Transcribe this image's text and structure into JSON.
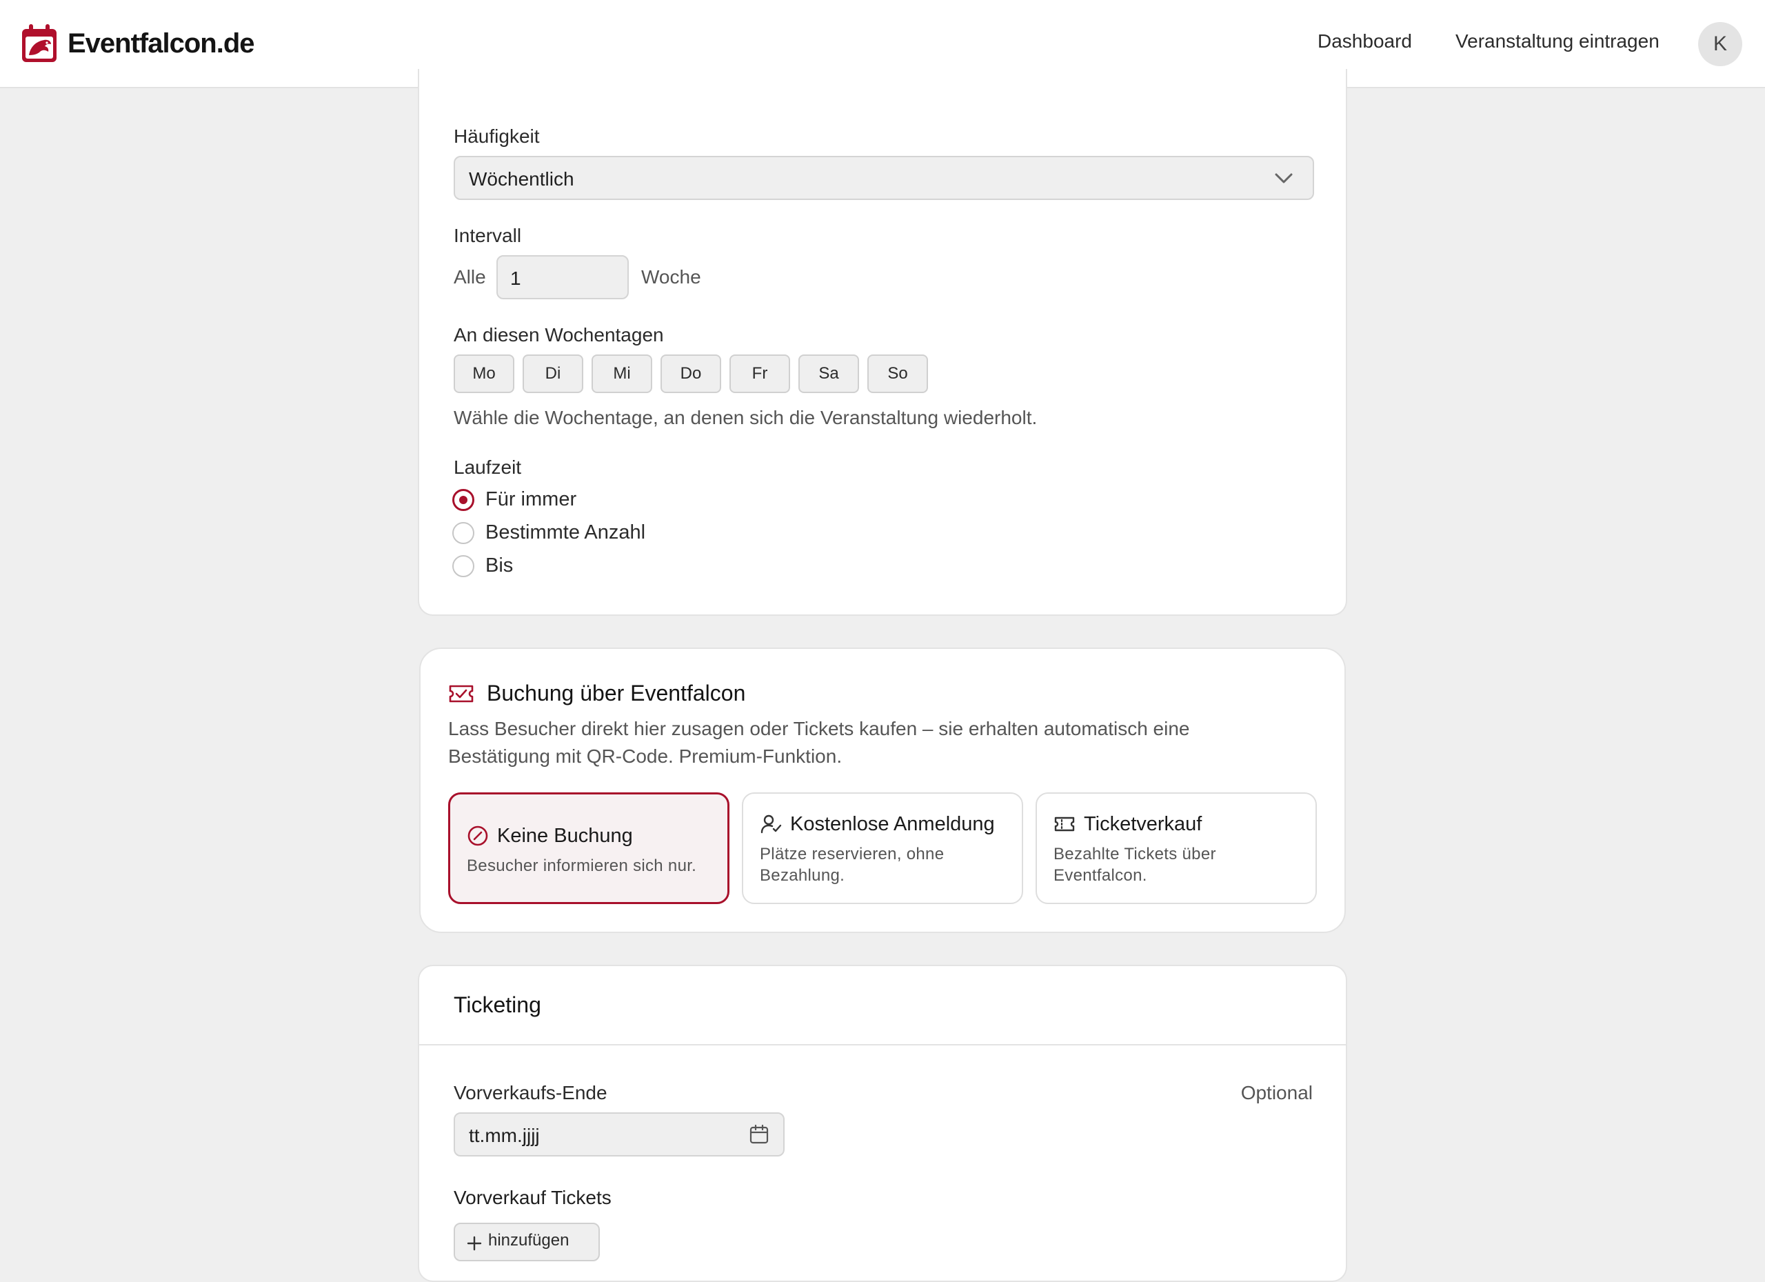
{
  "colors": {
    "accent": "#a8102b",
    "page_bg": "#efefef",
    "card_bg": "#ffffff"
  },
  "header": {
    "brand": "Eventfalcon.de",
    "nav": [
      "Dashboard",
      "Veranstaltung eintragen"
    ],
    "avatar_initial": "K"
  },
  "recurrence": {
    "frequency_label": "Häufigkeit",
    "frequency_value": "Wöchentlich",
    "interval_label": "Intervall",
    "interval_prefix": "Alle",
    "interval_value": "1",
    "interval_unit": "Woche",
    "weekdays_label": "An diesen Wochentagen",
    "weekdays": [
      "Mo",
      "Di",
      "Mi",
      "Do",
      "Fr",
      "Sa",
      "So"
    ],
    "weekdays_help": "Wähle die Wochentage, an denen sich die Veranstaltung wiederholt.",
    "duration_label": "Laufzeit",
    "duration_options": [
      "Für immer",
      "Bestimmte Anzahl",
      "Bis"
    ],
    "duration_selected": "Für immer"
  },
  "booking": {
    "title": "Buchung über Eventfalcon",
    "description_line1": "Lass Besucher direkt hier zusagen oder Tickets kaufen – sie erhalten automatisch eine",
    "description_line2": "Bestätigung mit QR-Code. Premium-Funktion.",
    "options": [
      {
        "title": "Keine Buchung",
        "desc": "Besucher informieren sich nur.",
        "icon": "circle-slash-icon",
        "selected": true
      },
      {
        "title": "Kostenlose Anmeldung",
        "desc_line1": "Plätze reservieren, ohne",
        "desc_line2": "Bezahlung.",
        "icon": "user-check-icon",
        "selected": false
      },
      {
        "title": "Ticketverkauf",
        "desc_line1": "Bezahlte Tickets über",
        "desc_line2": "Eventfalcon.",
        "icon": "ticket-icon",
        "selected": false
      }
    ]
  },
  "ticketing": {
    "title": "Ticketing",
    "presale_end_label": "Vorverkaufs-Ende",
    "optional": "Optional",
    "date_placeholder": "tt.mm.jjjj",
    "presale_tickets_label": "Vorverkauf Tickets",
    "add_button": "hinzufügen"
  }
}
